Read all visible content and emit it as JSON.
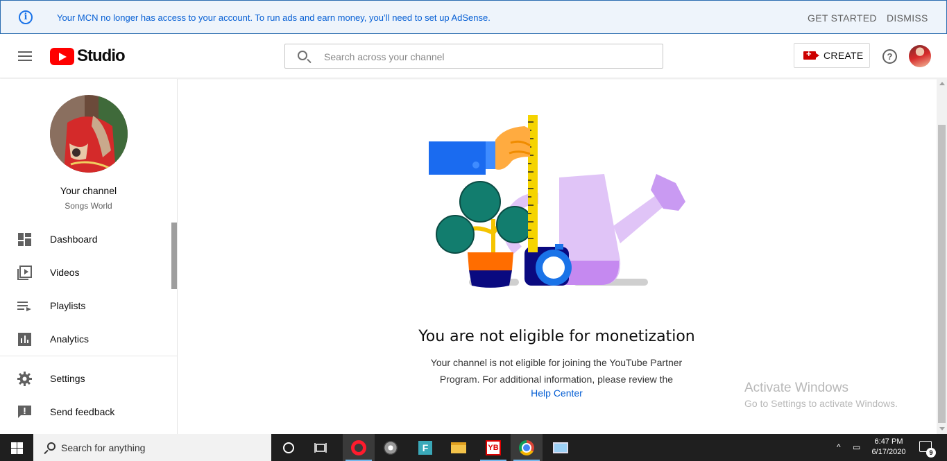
{
  "banner": {
    "message": "Your MCN no longer has access to your account. To run ads and earn money, you’ll need to set up AdSense.",
    "get_started": "GET STARTED",
    "dismiss": "DISMISS"
  },
  "header": {
    "logo_text": "Studio",
    "search_placeholder": "Search across your channel",
    "create_label": "CREATE",
    "help_glyph": "?"
  },
  "sidebar": {
    "channel_title": "Your channel",
    "channel_name": "Songs World",
    "items": [
      {
        "label": "Dashboard",
        "icon": "dashboard-icon"
      },
      {
        "label": "Videos",
        "icon": "videos-icon"
      },
      {
        "label": "Playlists",
        "icon": "playlists-icon"
      },
      {
        "label": "Analytics",
        "icon": "analytics-icon"
      },
      {
        "label": "Settings",
        "icon": "gear-icon"
      },
      {
        "label": "Send feedback",
        "icon": "feedback-icon"
      }
    ]
  },
  "main": {
    "heading": "You are not eligible for monetization",
    "description": "Your channel is not eligible for joining the YouTube Partner Program. For additional information, please review the",
    "help_link": "Help Center"
  },
  "watermark": {
    "line1": "Activate Windows",
    "line2": "Go to Settings to activate Windows."
  },
  "taskbar": {
    "search_text": "Search for anything",
    "time": "6:47 PM",
    "date": "6/17/2020",
    "notification_count": "9"
  },
  "colors": {
    "accent": "#065fd4",
    "brand_red": "#ff0000",
    "banner_bg": "#eef4fb"
  }
}
